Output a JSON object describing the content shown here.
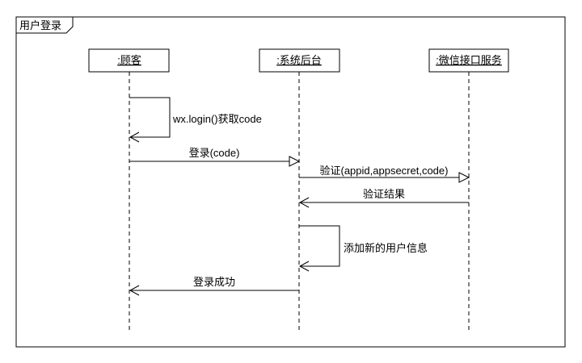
{
  "frame": {
    "title": "用户登录"
  },
  "lifelines": [
    {
      "label": ":顾客"
    },
    {
      "label": ":系统后台"
    },
    {
      "label": ":微信接口服务"
    }
  ],
  "messages": [
    {
      "from": 0,
      "to": 0,
      "label": "wx.login()获取code",
      "kind": "self"
    },
    {
      "from": 0,
      "to": 1,
      "label": "登录(code)",
      "kind": "sync"
    },
    {
      "from": 1,
      "to": 2,
      "label": "验证(appid,appsecret,code)",
      "kind": "sync"
    },
    {
      "from": 2,
      "to": 1,
      "label": "验证结果",
      "kind": "return"
    },
    {
      "from": 1,
      "to": 1,
      "label": "添加新的用户信息",
      "kind": "self"
    },
    {
      "from": 1,
      "to": 0,
      "label": "登录成功",
      "kind": "return"
    }
  ]
}
